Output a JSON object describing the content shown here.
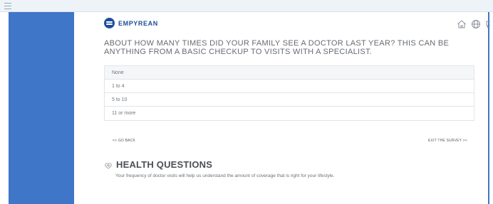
{
  "app": {
    "brand": "EMPYREAN"
  },
  "header_icons": [
    "home-icon",
    "globe-icon",
    "chat-icon"
  ],
  "question": {
    "text": "ABOUT HOW MANY TIMES DID YOUR FAMILY SEE A DOCTOR LAST YEAR? THIS CAN BE ANYTHING FROM A BASIC CHECKUP TO VISITS WITH A SPECIALIST."
  },
  "options": [
    {
      "label": "None"
    },
    {
      "label": "1 to 4"
    },
    {
      "label": "5 to 10"
    },
    {
      "label": "11 or more"
    }
  ],
  "nav": {
    "back_label": "<< GO BACK",
    "exit_label": "EXIT THE SURVEY >>"
  },
  "section": {
    "title": "HEALTH QUESTIONS",
    "body": "Your frequency of doctor visits will help us understand the amount of coverage that is right for your lifestyle."
  },
  "colors": {
    "sidebar": "#3f76c8",
    "brand": "#1d4e9a",
    "topbar": "#eef3f8"
  }
}
